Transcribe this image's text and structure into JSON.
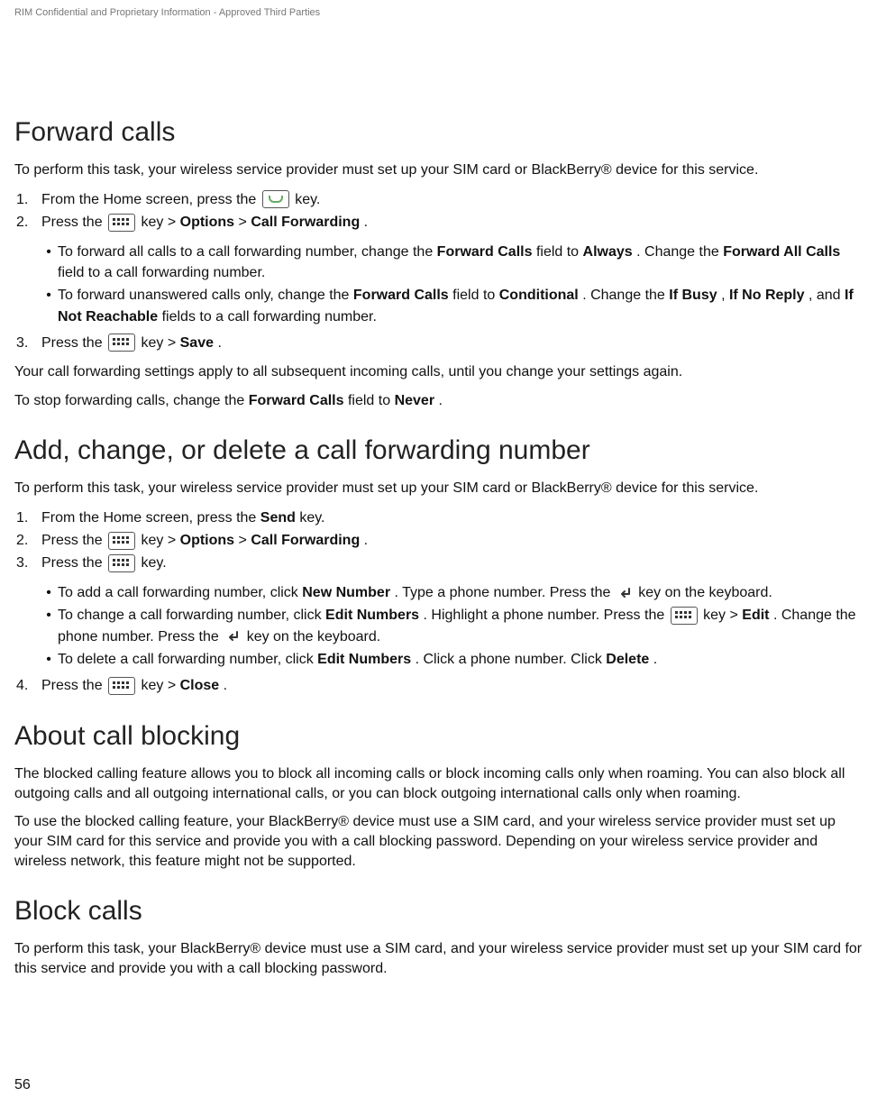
{
  "headerNote": "RIM Confidential and Proprietary Information - Approved Third Parties",
  "pageNumber": "56",
  "s1": {
    "title": "Forward calls",
    "intro": "To perform this task, your wireless service provider must set up your SIM card or BlackBerry® device for this service.",
    "step1_a": "From the Home screen, press the ",
    "step1_b": " key.",
    "step2_a": "Press the ",
    "step2_b": " key > ",
    "step2_opt": "Options",
    "step2_gt": " > ",
    "step2_cf": "Call Forwarding",
    "step2_end": ".",
    "b1_a": "To forward all calls to a call forwarding number, change the ",
    "b1_fc": "Forward Calls",
    "b1_b": " field to ",
    "b1_always": "Always",
    "b1_c": ". Change the ",
    "b1_fac": "Forward All Calls",
    "b1_d": " field to a call forwarding number.",
    "b2_a": "To forward unanswered calls only, change the ",
    "b2_fc": "Forward Calls",
    "b2_b": " field to ",
    "b2_cond": "Conditional",
    "b2_c": ". Change the ",
    "b2_ib": "If Busy",
    "b2_comma1": ", ",
    "b2_inr": "If No Reply",
    "b2_comma2": ", and ",
    "b2_inre": "If Not Reachable",
    "b2_d": " fields to a call forwarding number.",
    "step3_a": "Press the ",
    "step3_b": " key > ",
    "step3_save": "Save",
    "step3_end": ".",
    "outro1": "Your call forwarding settings apply to all subsequent incoming calls, until you change your settings again.",
    "outro2_a": "To stop forwarding calls, change the ",
    "outro2_fc": "Forward Calls",
    "outro2_b": " field to ",
    "outro2_never": "Never",
    "outro2_end": "."
  },
  "s2": {
    "title": "Add, change, or delete a call forwarding number",
    "intro": "To perform this task, your wireless service provider must set up your SIM card or BlackBerry® device for this service.",
    "step1_a": "From the Home screen, press the ",
    "step1_send": "Send",
    "step1_b": " key.",
    "step2_a": "Press the ",
    "step2_b": " key > ",
    "step2_opt": "Options",
    "step2_gt": " > ",
    "step2_cf": "Call Forwarding",
    "step2_end": ".",
    "step3_a": "Press the ",
    "step3_b": " key.",
    "b1_a": "To add a call forwarding number, click ",
    "b1_nn": "New Number",
    "b1_b": ". Type a phone number. Press the ",
    "b1_c": " key on the keyboard.",
    "b2_a": "To change a call forwarding number, click ",
    "b2_en": "Edit Numbers",
    "b2_b": ". Highlight a phone number. Press the ",
    "b2_c": " key > ",
    "b2_edit": "Edit",
    "b2_d": ". Change the phone number. Press the ",
    "b2_e": " key on the keyboard.",
    "b3_a": "To delete a call forwarding number, click ",
    "b3_en": "Edit Numbers",
    "b3_b": ". Click a phone number. Click ",
    "b3_del": "Delete",
    "b3_end": ".",
    "step4_a": "Press the ",
    "step4_b": " key > ",
    "step4_close": "Close",
    "step4_end": "."
  },
  "s3": {
    "title": "About call blocking",
    "p1": "The blocked calling feature allows you to block all incoming calls or block incoming calls only when roaming. You can also block all outgoing calls and all outgoing international calls, or you can block outgoing international calls only when roaming.",
    "p2": "To use the blocked calling feature, your BlackBerry® device must use a SIM card, and your wireless service provider must set up your SIM card for this service and provide you with a call blocking password. Depending on your wireless service provider and wireless network, this feature might not be supported."
  },
  "s4": {
    "title": "Block calls",
    "p1": "To perform this task, your BlackBerry® device must use a SIM card, and your wireless service provider must set up your SIM card for this service and provide you with a call blocking password."
  }
}
